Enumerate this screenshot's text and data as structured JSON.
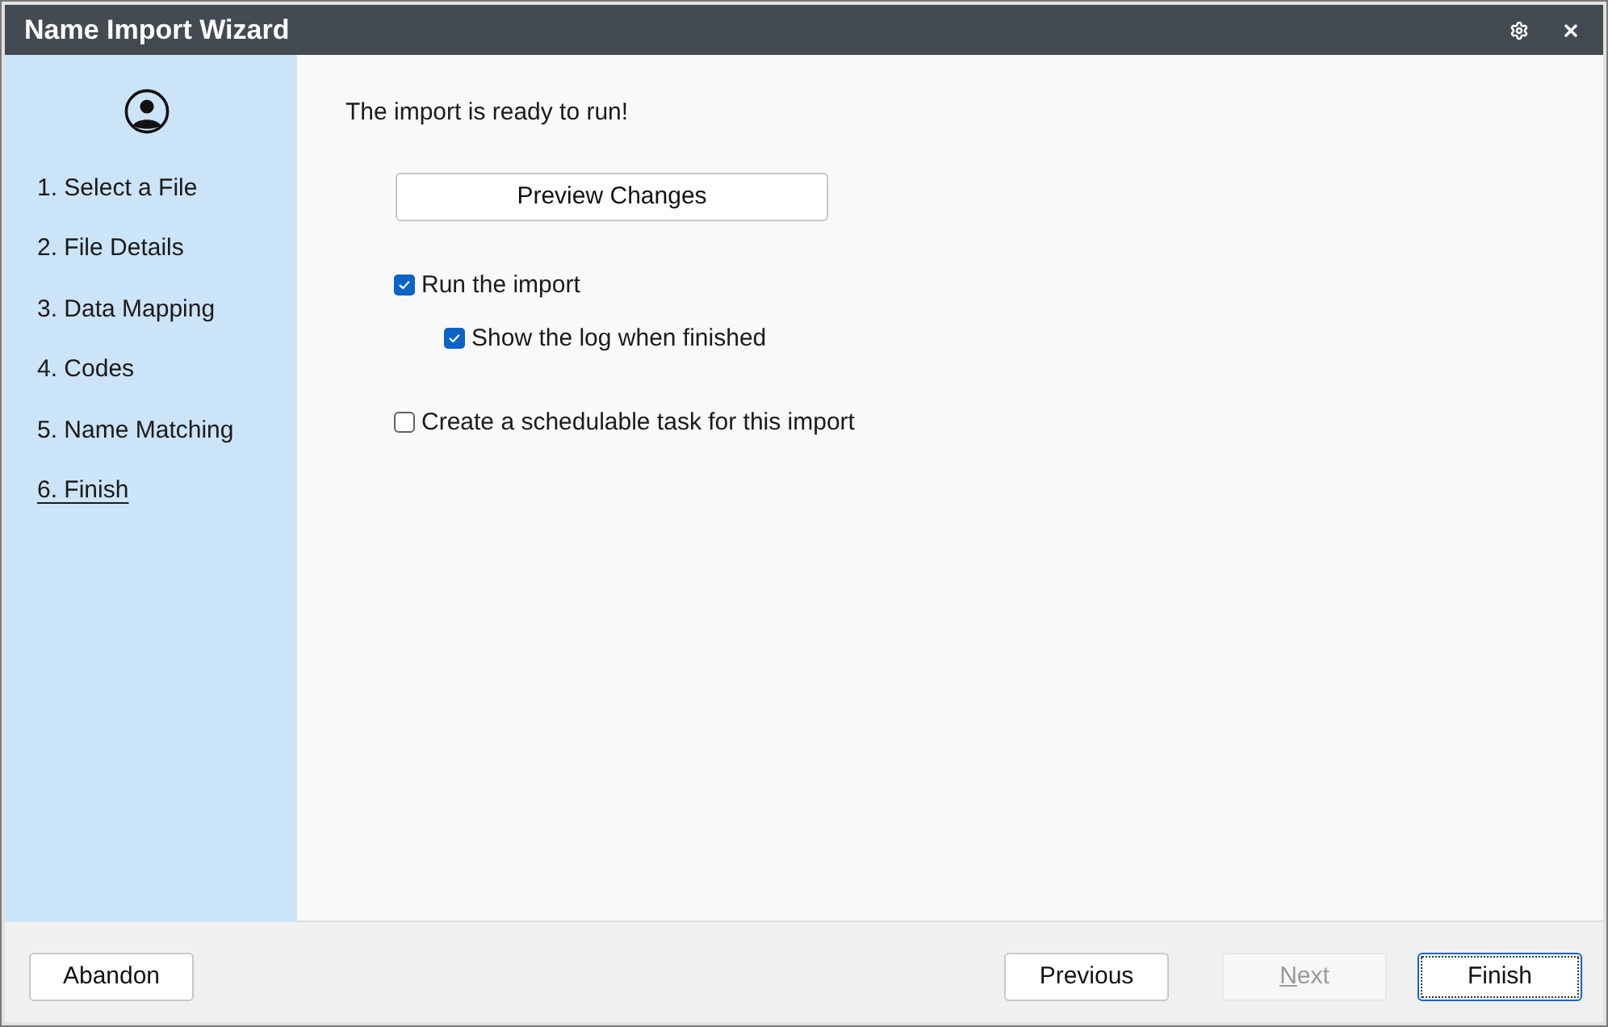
{
  "window": {
    "title": "Name Import Wizard"
  },
  "steps": [
    {
      "label": "1. Select a File",
      "selected": false
    },
    {
      "label": "2. File Details",
      "selected": false
    },
    {
      "label": "3. Data Mapping",
      "selected": false
    },
    {
      "label": "4. Codes",
      "selected": false
    },
    {
      "label": "5. Name Matching",
      "selected": false
    },
    {
      "label": "6. Finish",
      "selected": true
    }
  ],
  "main": {
    "heading": "The import is ready to run!",
    "preview_button": "Preview Changes",
    "options": [
      {
        "label": "Run the import",
        "checked": true,
        "children": [
          {
            "label": "Show the log when finished",
            "checked": true
          }
        ]
      },
      {
        "label": "Create a schedulable task for this import",
        "checked": false
      }
    ]
  },
  "footer": {
    "left_buttons": [
      {
        "label": "Abandon",
        "disabled": false,
        "focused": false,
        "mnemonic_underlined": false
      }
    ],
    "right_buttons": [
      {
        "label": "Previous",
        "disabled": false,
        "focused": false,
        "mnemonic_underlined": false
      },
      {
        "label": "Next",
        "disabled": true,
        "focused": false,
        "mnemonic_underlined": true
      },
      {
        "label": "Finish",
        "disabled": false,
        "focused": true,
        "mnemonic_underlined": false
      }
    ]
  }
}
